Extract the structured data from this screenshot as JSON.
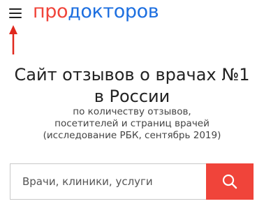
{
  "header": {
    "logo_part1": "про",
    "logo_part2": "докторов"
  },
  "hero": {
    "title_line1": "Сайт отзывов о врачах №1",
    "title_line2": "в России",
    "subtitle_line1": "по количеству отзывов,",
    "subtitle_line2": "посетителей и страниц врачей",
    "subtitle_line3": "(исследование РБК, сентябрь 2019)"
  },
  "search": {
    "placeholder": "Врачи, клиники, услуги",
    "value": ""
  },
  "icons": {
    "menu": "hamburger-icon",
    "search": "search-icon",
    "annotation": "arrow-up-icon"
  },
  "colors": {
    "logo_red": "#f0443a",
    "logo_blue": "#1d6fe0",
    "search_button": "#f0443a",
    "annotation_arrow": "#e0281e"
  }
}
